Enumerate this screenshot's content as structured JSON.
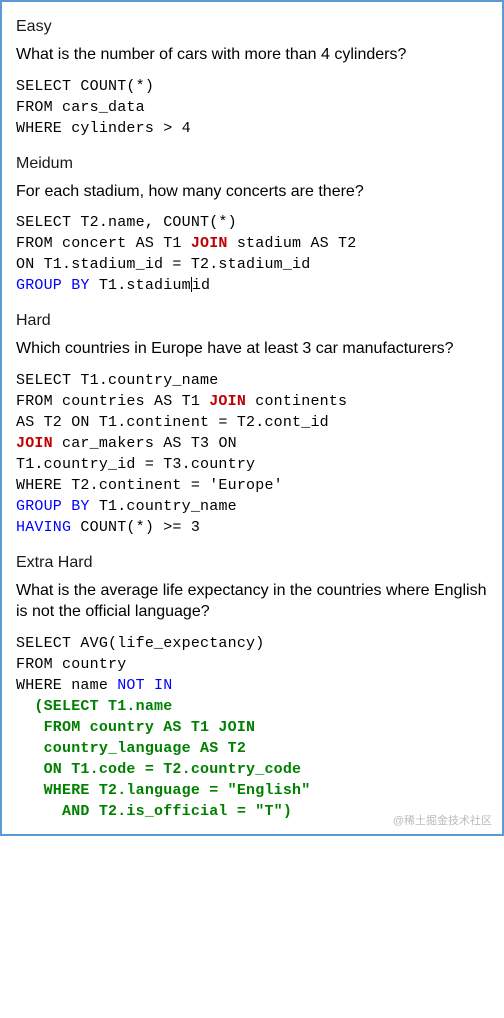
{
  "sections": {
    "easy": {
      "title": "Easy",
      "question": "What is the number of cars with more than 4 cylinders?"
    },
    "medium": {
      "title": "Meidum",
      "question": "For each stadium, how many concerts are there?"
    },
    "hard": {
      "title": "Hard",
      "question": "Which countries in Europe have at least 3 car manufacturers?"
    },
    "extrahard": {
      "title": "Extra Hard",
      "question": "What is the average life expectancy in the countries where English is not the official language?"
    }
  },
  "code_tokens": {
    "easy": {
      "l1": "SELECT COUNT(*)",
      "l2": "FROM cars_data",
      "l3": "WHERE cylinders > 4"
    },
    "medium": {
      "l1": "SELECT T2.name, COUNT(*)",
      "l2a": "FROM concert AS T1 ",
      "l2b": "JOIN",
      "l2c": " stadium AS T2",
      "l3": "ON T1.stadium_id = T2.stadium_id",
      "l4a": "GROUP BY",
      "l4b": " T1.stadium",
      "l4c": "id"
    },
    "hard": {
      "l1": "SELECT T1.country_name",
      "l2a": "FROM countries AS T1 ",
      "l2b": "JOIN",
      "l2c": " continents",
      "l3": "AS T2 ON T1.continent = T2.cont_id",
      "l4a": "JOIN",
      "l4b": " car_makers AS T3 ON",
      "l5": "T1.country_id = T3.country",
      "l6": "WHERE T2.continent = 'Europe'",
      "l7a": "GROUP BY",
      "l7b": " T1.country_name",
      "l8a": "HAVING",
      "l8b": " COUNT(*) >= 3"
    },
    "extrahard": {
      "l1": "SELECT AVG(life_expectancy)",
      "l2": "FROM country",
      "l3a": "WHERE name ",
      "l3b": "NOT IN",
      "l4": "  (SELECT T1.name",
      "l5": "   FROM country AS T1 JOIN",
      "l6": "   country_language AS T2",
      "l7": "   ON T1.code = T2.country_code",
      "l8": "   WHERE T2.language = \"English\"",
      "l9": "     AND T2.is_official = \"T\")"
    }
  },
  "watermark": "@稀土掘金技术社区"
}
